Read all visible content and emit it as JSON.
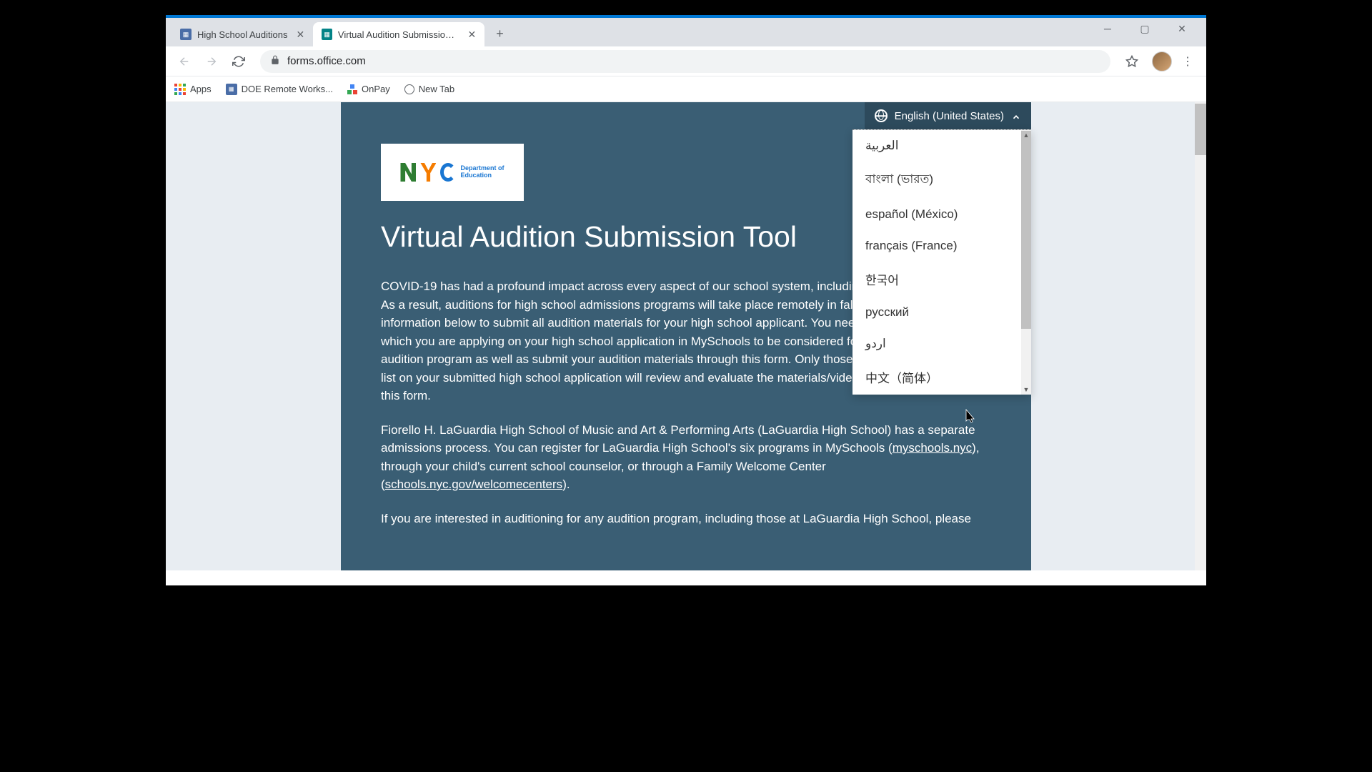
{
  "tabs": [
    {
      "title": "High School Auditions",
      "active": false
    },
    {
      "title": "Virtual Audition Submission Tool",
      "active": true
    }
  ],
  "address_bar": {
    "url": "forms.office.com"
  },
  "bookmarks": [
    {
      "label": "Apps",
      "icon": "apps-grid"
    },
    {
      "label": "DOE Remote Works...",
      "icon": "doc"
    },
    {
      "label": "OnPay",
      "icon": "onpay"
    },
    {
      "label": "New Tab",
      "icon": "globe"
    }
  ],
  "language_selector": {
    "current": "English (United States)",
    "options": [
      "العربية",
      "বাংলা (ভারত)",
      "español (México)",
      "français (France)",
      "한국어",
      "русский",
      "اردو",
      "中文（简体）"
    ]
  },
  "logo": {
    "org": "Department of",
    "org2": "Education"
  },
  "form": {
    "title": "Virtual Audition Submission Tool",
    "p1": "COVID-19 has had a profound impact across every aspect of our school system, including the audition process. As a result, auditions for high school admissions programs will take place remotely in fall 2020. Complete the information below to submit all audition materials for your high school applicant. You need to list the program(s) to which you are applying on your high school application in MySchools to be considered for admission to any arts audition program as well as submit your audition materials through this form. Only those audition programs you list on your submitted high school application will review and evaluate the materials/videos you submit through this form.",
    "p2a": "Fiorello H. LaGuardia High School of Music and Art & Performing Arts (LaGuardia High School) has a separate admissions process. You can register for LaGuardia High School's six programs in MySchools (",
    "link1": "myschools.nyc",
    "p2b": "), through your child's current school counselor, or through a Family Welcome Center (",
    "link2": "schools.nyc.gov/welcomecenters",
    "p2c": ").",
    "p3": "If you are interested in auditioning for any audition program, including those at LaGuardia High School, please"
  }
}
